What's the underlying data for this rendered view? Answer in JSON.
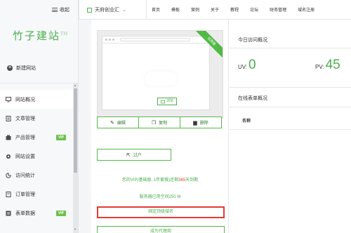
{
  "sidebar": {
    "collapse_label": "收起",
    "logo_text": "竹子建站",
    "logo_tm": "TM",
    "new_site_label": "新建网站",
    "items": [
      {
        "label": "网站概况",
        "icon": "monitor-icon",
        "vip": false,
        "active": true
      },
      {
        "label": "文章管理",
        "icon": "document-icon",
        "vip": false,
        "active": false
      },
      {
        "label": "产品管理",
        "icon": "box-icon",
        "vip": true,
        "active": false
      },
      {
        "label": "网站设置",
        "icon": "gear-icon",
        "vip": false,
        "active": false
      },
      {
        "label": "访问统计",
        "icon": "chart-icon",
        "vip": false,
        "active": false
      },
      {
        "label": "订单管理",
        "icon": "cart-icon",
        "vip": false,
        "active": false
      },
      {
        "label": "表单数据",
        "icon": "form-icon",
        "vip": true,
        "active": false
      }
    ],
    "vip_badge": "VIP"
  },
  "topbar": {
    "site_select": "天府创业汇",
    "nav": [
      "首页",
      "模板",
      "案例",
      "关于",
      "教程",
      "论坛",
      "财务管理",
      "域名注册"
    ]
  },
  "preview": {
    "ribbon": "试用版",
    "view_button": "浏览"
  },
  "actions": {
    "edit": "编辑",
    "copy": "复制",
    "delete": "删除",
    "transfer": "过户"
  },
  "status": {
    "vip_prefix": "您的VIP(基础版, 1年套餐)还剩",
    "vip_days": "365",
    "vip_suffix": "天到期",
    "space": "服务器已用空间250 M",
    "bind_domain": "绑定顶级域名",
    "become_agent": "成为代理商"
  },
  "stats": {
    "title": "今日访问概况",
    "uv_label": "UV:",
    "uv_value": "0",
    "pv_label": "PV:",
    "pv_value": "45"
  },
  "forms": {
    "title": "在线表单概况",
    "column_name": "名称"
  },
  "colors": {
    "brand_green": "#4caf50",
    "highlight_red": "#e53935"
  }
}
